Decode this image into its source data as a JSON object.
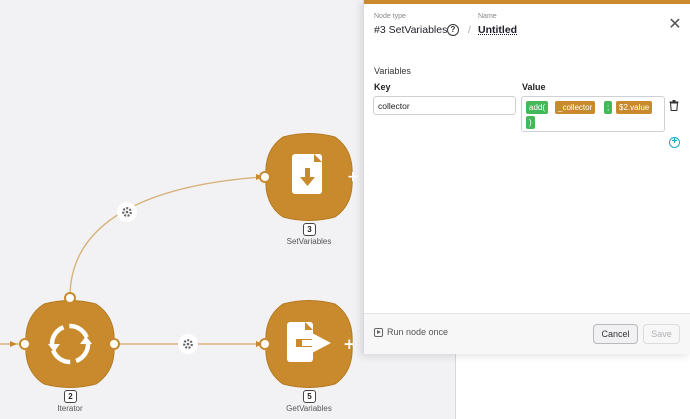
{
  "canvas": {
    "nodes": [
      {
        "id": "3",
        "label": "SetVariables",
        "icon": "file-download-icon"
      },
      {
        "id": "2",
        "label": "Iterator",
        "icon": "loop-icon"
      },
      {
        "id": "5",
        "label": "GetVariables",
        "icon": "file-export-icon"
      }
    ],
    "node_color": "#c88a2c",
    "connector_icon": "gear-icon"
  },
  "panel": {
    "node_type_caption": "Node type",
    "node_type_value": "#3 SetVariables",
    "name_caption": "Name",
    "name_value": "Untitled",
    "separator": "/",
    "variables_title": "Variables",
    "key_header": "Key",
    "value_header": "Value",
    "rows": [
      {
        "key": "collector",
        "value_chips": [
          {
            "text": "add(",
            "color": "green"
          },
          {
            "text": "_collector",
            "color": "orange"
          },
          {
            "text": ";",
            "color": "green"
          },
          {
            "text": "$2.value",
            "color": "orange"
          },
          {
            "text": ")",
            "color": "green"
          }
        ]
      }
    ],
    "run_once_label": "Run node once",
    "cancel_label": "Cancel",
    "save_label": "Save",
    "accent_color": "#c88a2c"
  }
}
